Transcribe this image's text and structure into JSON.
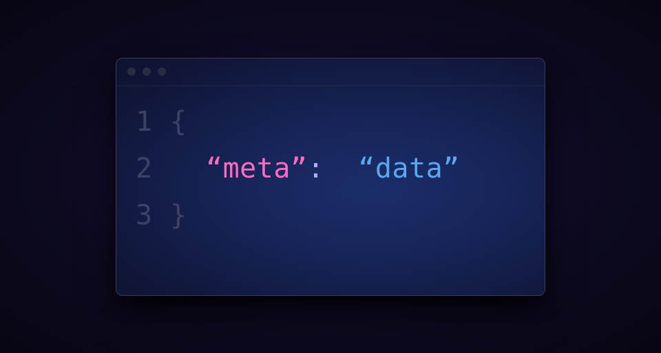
{
  "editor": {
    "lines": {
      "n1": "1",
      "n2": "2",
      "n3": "3",
      "brace_open": "{",
      "brace_close": "}",
      "key_quoted": "“meta”",
      "colon": ":",
      "value_quoted": "“data”"
    }
  },
  "colors": {
    "key": "#ff6bc1",
    "colon": "#b8a9ff",
    "value": "#5aa8f0",
    "muted": "#3d4266"
  }
}
